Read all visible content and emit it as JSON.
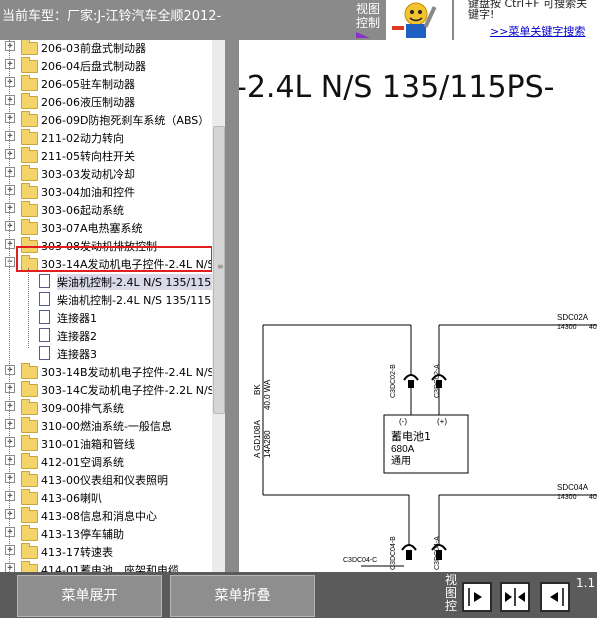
{
  "header": {
    "vehicle_label": "当前车型：厂家:J-江铃汽车全顺2012-",
    "view_control": [
      "视图",
      "控制"
    ],
    "hint_text": "键盘按 Ctrl+F 可搜索关键字!",
    "hint_link": ">>菜单关键字搜索"
  },
  "tree": {
    "items": [
      {
        "label": "206-03前盘式制动器",
        "type": "folder",
        "level": 0
      },
      {
        "label": "206-04后盘式制动器",
        "type": "folder",
        "level": 0
      },
      {
        "label": "206-05驻车制动器",
        "type": "folder",
        "level": 0
      },
      {
        "label": "206-06液压制动器",
        "type": "folder",
        "level": 0
      },
      {
        "label": "206-09D防抱死刹车系统（ABS）",
        "type": "folder",
        "level": 0
      },
      {
        "label": "211-02动力转向",
        "type": "folder",
        "level": 0
      },
      {
        "label": "211-05转向柱开关",
        "type": "folder",
        "level": 0
      },
      {
        "label": "303-03发动机冷却",
        "type": "folder",
        "level": 0
      },
      {
        "label": "303-04加油和控件",
        "type": "folder",
        "level": 0
      },
      {
        "label": "303-06起动系统",
        "type": "folder",
        "level": 0
      },
      {
        "label": "303-07A电热塞系统",
        "type": "folder",
        "level": 0
      },
      {
        "label": "303-08发动机排放控制",
        "type": "folder",
        "level": 0
      },
      {
        "label": "303-14A发动机电子控件-2.4L N/S",
        "type": "folder-open",
        "level": 0
      },
      {
        "label": "柴油机控制-2.4L N/S 135/115PS",
        "type": "doc",
        "level": 1,
        "selected": true
      },
      {
        "label": "柴油机控制-2.4L N/S 135/115PS",
        "type": "doc",
        "level": 1
      },
      {
        "label": "连接器1",
        "type": "doc",
        "level": 1
      },
      {
        "label": "连接器2",
        "type": "doc",
        "level": 1
      },
      {
        "label": "连接器3",
        "type": "doc",
        "level": 1
      },
      {
        "label": "303-14B发动机电子控件-2.4L N/S",
        "type": "folder",
        "level": 0
      },
      {
        "label": "303-14C发动机电子控件-2.2L N/S",
        "type": "folder",
        "level": 0
      },
      {
        "label": "309-00排气系统",
        "type": "folder",
        "level": 0
      },
      {
        "label": "310-00燃油系统-一般信息",
        "type": "folder",
        "level": 0
      },
      {
        "label": "310-01油箱和管线",
        "type": "folder",
        "level": 0
      },
      {
        "label": "412-01空调系统",
        "type": "folder",
        "level": 0
      },
      {
        "label": "413-00仪表组和仪表照明",
        "type": "folder",
        "level": 0
      },
      {
        "label": "413-06喇叭",
        "type": "folder",
        "level": 0
      },
      {
        "label": "413-08信息和消息中心",
        "type": "folder",
        "level": 0
      },
      {
        "label": "413-13停车辅助",
        "type": "folder",
        "level": 0
      },
      {
        "label": "413-17转速表",
        "type": "folder",
        "level": 0
      },
      {
        "label": "414-01蓄电池、座架和电缆",
        "type": "folder",
        "level": 0
      }
    ]
  },
  "diagram": {
    "title": "-2.4L N/S 135/115PS-",
    "connector_top_right": "SDC02A",
    "connector_top_right_nums": [
      "14300",
      "40"
    ],
    "connector_bottom_right": "SDC04A",
    "connector_bottom_right_nums": [
      "14300",
      "40"
    ],
    "wire_left_labels": [
      "BK",
      "40.0 WA",
      "A GD108A",
      "14A280"
    ],
    "pin_left": "C3DC02-B",
    "pin_right": "C3DC02-A",
    "minus": "(-)",
    "plus": "(+)",
    "battery_label": "蓄电池1",
    "battery_spec": "680A",
    "battery_type": "通用",
    "pin_bottom_left": "C3DC04-B",
    "pin_bottom_right": "C3DC04-A",
    "pin_bottom_c": "C3DC04-C"
  },
  "footer": {
    "expand_label": "菜单展开",
    "collapse_label": "菜单折叠",
    "view_control": [
      "视",
      "图",
      "控"
    ],
    "page_num": "1.1"
  },
  "colors": {
    "header_bg": "#8a8a8a",
    "footer_bg": "#5b5b5b",
    "highlight": "#e02020",
    "link": "#0000cc"
  }
}
